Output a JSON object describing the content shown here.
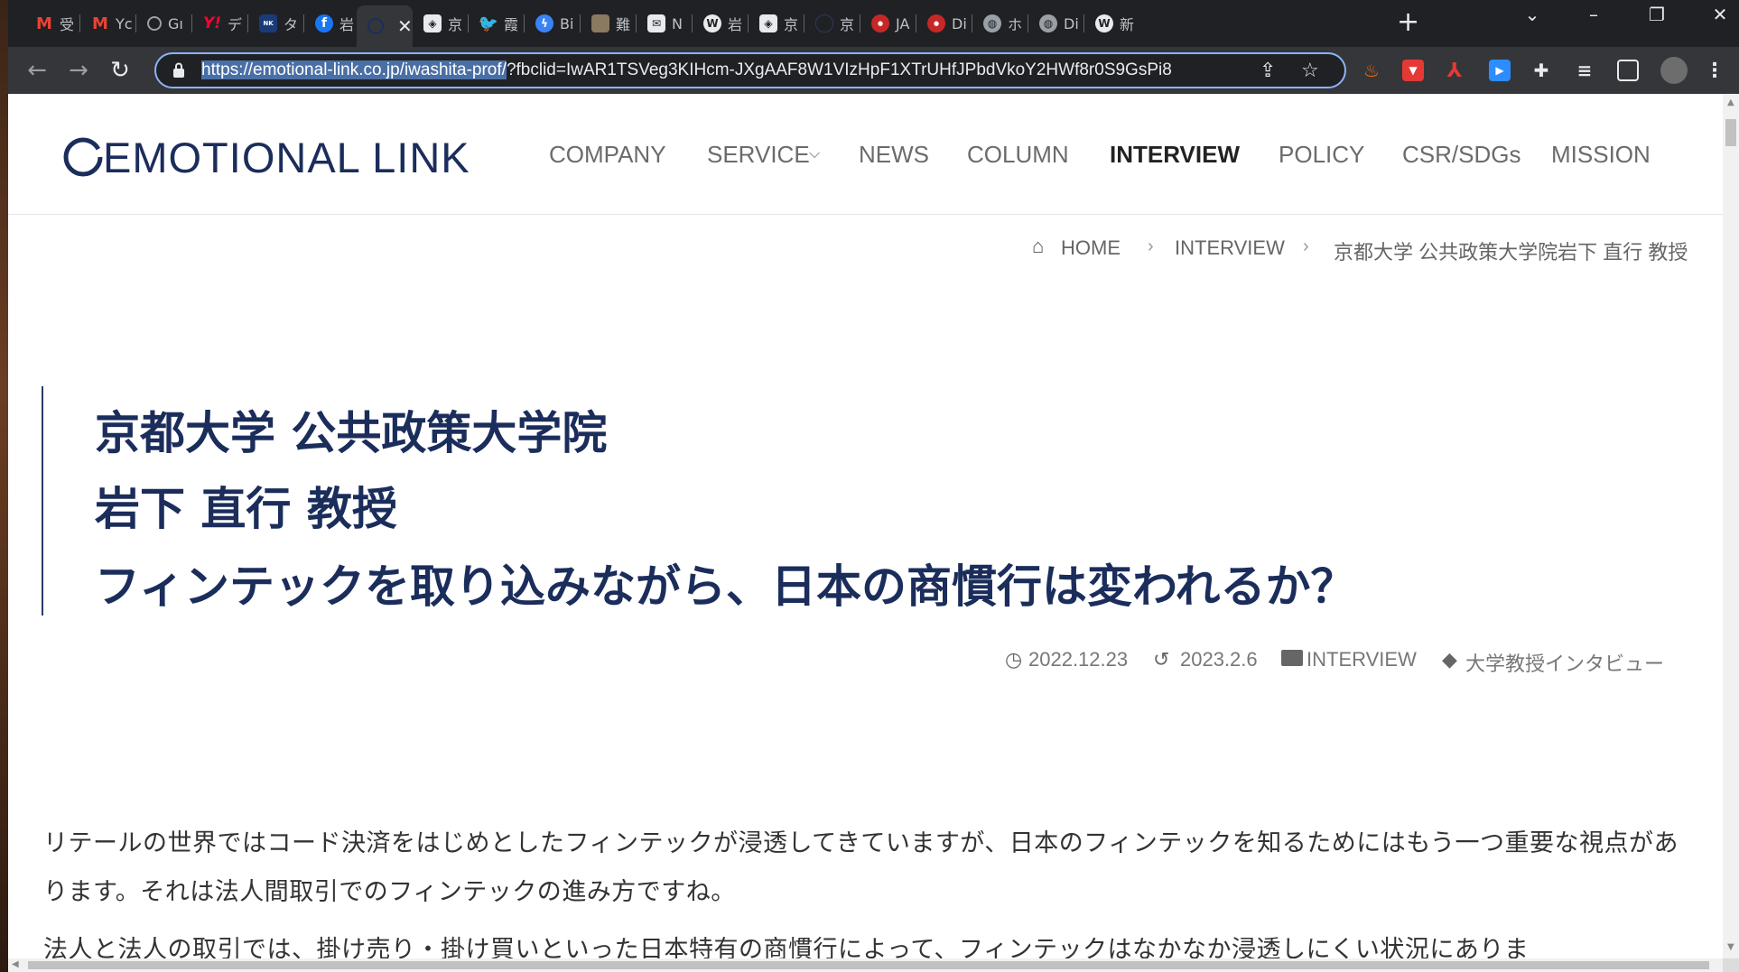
{
  "browser": {
    "tabs": [
      {
        "label": "受",
        "favicon": "gmail-icon",
        "color": "#ea4335"
      },
      {
        "label": "Yc",
        "favicon": "gmail-icon",
        "color": "#ea4335"
      },
      {
        "label": "Gı",
        "favicon": "github-icon",
        "color": "#5f6368"
      },
      {
        "label": "デ",
        "favicon": "yahoo-icon",
        "color": "#ff0033"
      },
      {
        "label": "タ",
        "favicon": "nikkei-icon",
        "color": "#1a3a7a"
      },
      {
        "label": "岩",
        "favicon": "facebook-icon",
        "color": "#1877f2"
      },
      {
        "label": "",
        "favicon": "emotional-link-icon",
        "color": "#1b2d5b"
      },
      {
        "label": "京",
        "favicon": "note-icon",
        "color": "#444444"
      },
      {
        "label": "霞",
        "favicon": "twitter-icon",
        "color": "#1d9bf0"
      },
      {
        "label": "Bi",
        "favicon": "messenger-icon",
        "color": "#3b82f6"
      },
      {
        "label": "難",
        "favicon": "photo-icon",
        "color": "#8a7a60"
      },
      {
        "label": "N",
        "favicon": "newsletter-icon",
        "color": "#666666"
      },
      {
        "label": "岩",
        "favicon": "wordpress-icon",
        "color": "#3a3a3a"
      },
      {
        "label": "京",
        "favicon": "note-icon",
        "color": "#444444"
      },
      {
        "label": "京",
        "favicon": "circle-icon",
        "color": "#1b2d5b"
      },
      {
        "label": "JA",
        "favicon": "hops-icon",
        "color": "#c62828"
      },
      {
        "label": "Di",
        "favicon": "hops-icon",
        "color": "#c62828"
      },
      {
        "label": "ホ",
        "favicon": "globe-icon",
        "color": "#5f6368"
      },
      {
        "label": "Di",
        "favicon": "globe-icon",
        "color": "#5f6368"
      },
      {
        "label": "新",
        "favicon": "wordpress-icon",
        "color": "#3a3a3a"
      }
    ],
    "new_tab": "+",
    "url_selected": "https://emotional-link.co.jp/iwashita-prof/",
    "url_rest": "?fbclid=IwAR1TSVeg3KIHcm-JXgAAF8W1VIzHpF1XTrUHfJPbdVkoY2HWf8r0S9GsPi8"
  },
  "site": {
    "logo": "EMOTIONAL LINK",
    "nav": [
      "COMPANY",
      "SERVICE",
      "NEWS",
      "COLUMN",
      "INTERVIEW",
      "POLICY",
      "CSR/SDGs",
      "MISSION"
    ],
    "breadcrumb": {
      "home": "HOME",
      "section": "INTERVIEW",
      "current": "京都大学 公共政策大学院岩下 直行 教授"
    }
  },
  "article": {
    "title_lines": [
      "京都大学 公共政策大学院",
      "岩下 直行 教授",
      "フィンテックを取り込みながら、日本の商慣行は変われるか？"
    ],
    "published": "2022.12.23",
    "updated": "2023.2.6",
    "category": "INTERVIEW",
    "tag": "大学教授インタビュー",
    "paragraphs": [
      "リテールの世界ではコード決済をはじめとしたフィンテックが浸透してきていますが、日本のフィンテックを知るためにはもう一つ重要な視点があります。それは法人間取引でのフィンテックの進み方ですね。",
      "法人と法人の取引では、掛け売り・掛け買いといった日本特有の商慣行によって、フィンテックはなかなか浸透しにくい状況にありま"
    ]
  }
}
